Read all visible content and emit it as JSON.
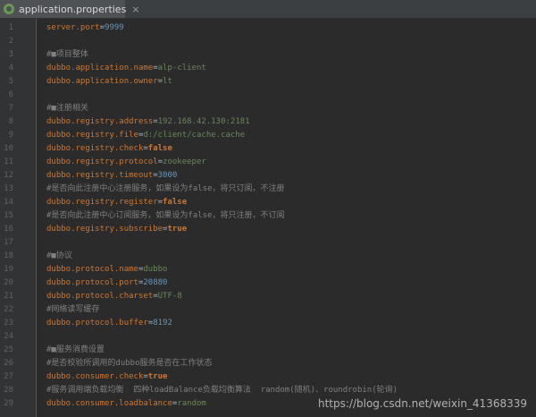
{
  "tab": {
    "filename": "application.properties",
    "close_glyph": "×"
  },
  "lines": [
    {
      "n": "1",
      "type": "kv",
      "key": "server.port",
      "value": "9999",
      "vtype": "num"
    },
    {
      "n": "2",
      "type": "blank",
      "text": ""
    },
    {
      "n": "3",
      "type": "comment",
      "text": "#■项目整体"
    },
    {
      "n": "4",
      "type": "kv",
      "key": "dubbo.application.name",
      "value": "alp-client",
      "vtype": "str"
    },
    {
      "n": "5",
      "type": "kv",
      "key": "dubbo.application.owner",
      "value": "lt",
      "vtype": "str"
    },
    {
      "n": "6",
      "type": "blank",
      "text": ""
    },
    {
      "n": "7",
      "type": "comment",
      "text": "#■注册相关"
    },
    {
      "n": "8",
      "type": "kv",
      "key": "dubbo.registry.address",
      "value": "192.168.42.130:2181",
      "vtype": "str"
    },
    {
      "n": "9",
      "type": "kv",
      "key": "dubbo.registry.file",
      "value": "d:/client/cache.cache",
      "vtype": "str"
    },
    {
      "n": "10",
      "type": "kv",
      "key": "dubbo.registry.check",
      "value": "false",
      "vtype": "bool"
    },
    {
      "n": "11",
      "type": "kv",
      "key": "dubbo.registry.protocol",
      "value": "zookeeper",
      "vtype": "str"
    },
    {
      "n": "12",
      "type": "kv",
      "key": "dubbo.registry.timeout",
      "value": "3000",
      "vtype": "num"
    },
    {
      "n": "13",
      "type": "comment",
      "text": "#是否向此注册中心注册服务，如果设为false，将只订阅，不注册"
    },
    {
      "n": "14",
      "type": "kv",
      "key": "dubbo.registry.register",
      "value": "false",
      "vtype": "bool"
    },
    {
      "n": "15",
      "type": "comment",
      "text": "#是否向此注册中心订阅服务，如果设为false，将只注册，不订阅"
    },
    {
      "n": "16",
      "type": "kv",
      "key": "dubbo.registry.subscribe",
      "value": "true",
      "vtype": "bool"
    },
    {
      "n": "17",
      "type": "blank",
      "text": ""
    },
    {
      "n": "18",
      "type": "comment",
      "text": "#■协议"
    },
    {
      "n": "19",
      "type": "kv",
      "key": "dubbo.protocol.name",
      "value": "dubbo",
      "vtype": "str"
    },
    {
      "n": "20",
      "type": "kv",
      "key": "dubbo.protocol.port",
      "value": "20880",
      "vtype": "num"
    },
    {
      "n": "21",
      "type": "kv",
      "key": "dubbo.protocol.charset",
      "value": "UTF-8",
      "vtype": "str"
    },
    {
      "n": "22",
      "type": "comment",
      "text": "#网络读写缓存"
    },
    {
      "n": "23",
      "type": "kv",
      "key": "dubbo.protocol.buffer",
      "value": "8192",
      "vtype": "num"
    },
    {
      "n": "24",
      "type": "blank",
      "text": ""
    },
    {
      "n": "25",
      "type": "comment",
      "text": "#■服务消费设置"
    },
    {
      "n": "26",
      "type": "comment",
      "text": "#是否校验所调用的dubbo服务是否在工作状态"
    },
    {
      "n": "27",
      "type": "kv",
      "key": "dubbo.consumer.check",
      "value": "true",
      "vtype": "bool"
    },
    {
      "n": "28",
      "type": "comment",
      "text": "#服务调用端负载均衡  四种loadBalance负载均衡算法  random(随机)、roundrobin(轮询)"
    },
    {
      "n": "29",
      "type": "kv",
      "key": "dubbo.consumer.loadbalance",
      "value": "random",
      "vtype": "str"
    }
  ],
  "watermark": "https://blog.csdn.net/weixin_41368339"
}
